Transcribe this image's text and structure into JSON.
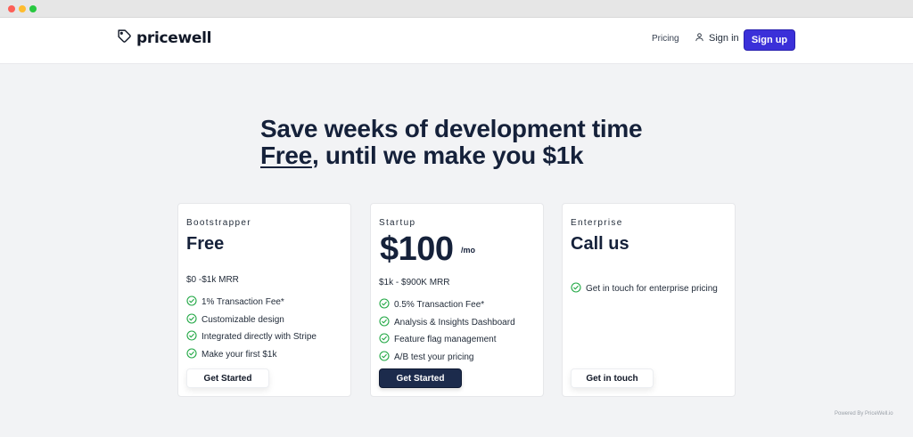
{
  "header": {
    "logo_text": "pricewell",
    "nav_pricing": "Pricing",
    "nav_signin": "Sign in",
    "signup_label": "Sign up"
  },
  "hero": {
    "line1": "Save weeks of development time",
    "line2_em": "Free",
    "line2_rest": ", until we make you $1k"
  },
  "plans": [
    {
      "name": "Bootstrapper",
      "price": "Free",
      "mrr": "$0 -$1k MRR",
      "features": [
        "1% Transaction Fee*",
        "Customizable design",
        "Integrated directly with Stripe",
        "Make your first $1k"
      ],
      "button": "Get Started"
    },
    {
      "name": "Startup",
      "price": "$100",
      "price_unit": "/mo",
      "mrr": "$1k - $900K MRR",
      "features": [
        "0.5% Transaction Fee*",
        "Analysis & Insights Dashboard",
        "Feature flag management",
        "A/B test your pricing"
      ],
      "button": "Get Started"
    },
    {
      "name": "Enterprise",
      "price": "Call us",
      "features": [
        "Get in touch for enterprise pricing"
      ],
      "button": "Get in touch"
    }
  ],
  "footer": {
    "powered": "Powered By PriceWell.io"
  },
  "colors": {
    "accent": "#3b30d9",
    "dark_button": "#1c2b4c",
    "check": "#22a845",
    "background": "#f2f3f5"
  },
  "icons": {
    "logo": "price-tag-icon",
    "signin": "user-icon",
    "feature": "check-circle-icon"
  }
}
